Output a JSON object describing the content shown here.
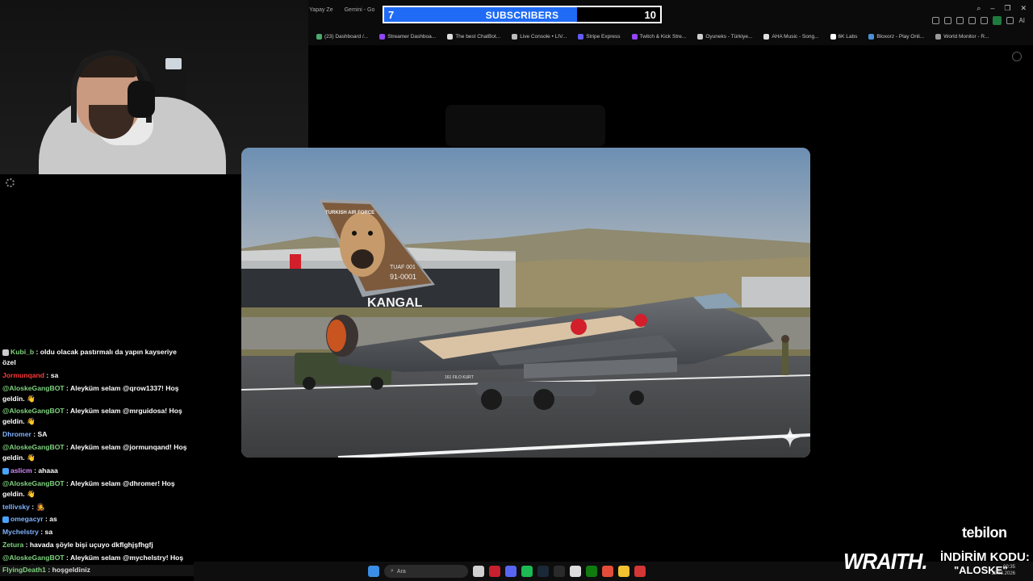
{
  "browser": {
    "tabs": [
      "gle Yapay Ze",
      "Gemini - Go"
    ],
    "bookmarks": [
      {
        "label": "(23) Dashboard /...",
        "color": "#4aa96c"
      },
      {
        "label": "Streamer Dashboa...",
        "color": "#9146ff"
      },
      {
        "label": "The best ChatBot...",
        "color": "#dddddd"
      },
      {
        "label": "Live Console • LIV...",
        "color": "#bbbbbb"
      },
      {
        "label": "Stripe Express",
        "color": "#635bff"
      },
      {
        "label": "Twitch & Kick Stre...",
        "color": "#9146ff"
      },
      {
        "label": "Oyuneks - Türkiye...",
        "color": "#cccccc"
      },
      {
        "label": "AHA Music - Song...",
        "color": "#e0e0e0"
      },
      {
        "label": "6K Labs",
        "color": "#ffffff"
      },
      {
        "label": "Bloxorz - Play Onli...",
        "color": "#4a90d9"
      },
      {
        "label": "World Monitor - R...",
        "color": "#999999"
      }
    ],
    "toolbar_ai": "AI"
  },
  "subscribers_goal": {
    "current": "7",
    "label": "SUBSCRIBERS",
    "target": "10",
    "progress": 0.7,
    "fill_color": "#1f6bf5"
  },
  "photo": {
    "tail_text": "TURKISH AIR FORCE",
    "tail_code_1": "TUAF 001",
    "tail_code_2": "91-0001",
    "name": "KANGAL",
    "squadron": "161 FILO KURT"
  },
  "chat": {
    "messages": [
      {
        "user": "Kubi_b",
        "text": "oldu olacak pastırmalı da yapın kayseriye özel",
        "user_color": "#7fd37f",
        "badge": "#cccccc"
      },
      {
        "user": "Jormunqand",
        "text": "sa",
        "user_color": "#ff3a3a",
        "badge": ""
      },
      {
        "user": "@AloskeGangBOT",
        "text": "Aleyküm selam @qrow1337! Hoş geldin. 👋",
        "user_color": "#7fd37f",
        "badge": ""
      },
      {
        "user": "@AloskeGangBOT",
        "text": "Aleyküm selam @mrguidosa! Hoş geldin. 👋",
        "user_color": "#7fd37f",
        "badge": ""
      },
      {
        "user": "Dhromer",
        "text": "SA",
        "user_color": "#7fb2ff",
        "badge": ""
      },
      {
        "user": "@AloskeGangBOT",
        "text": "Aleyküm selam @jormunqand! Hoş geldin. 👋",
        "user_color": "#7fd37f",
        "badge": ""
      },
      {
        "user": "aslicm",
        "text": "ahaaa",
        "user_color": "#d58cff",
        "badge": "#4aa3ff"
      },
      {
        "user": "@AloskeGangBOT",
        "text": "Aleyküm selam @dhromer! Hoş geldin. 👋",
        "user_color": "#7fd37f",
        "badge": ""
      },
      {
        "user": "tellivsky",
        "text": "🧑‍🎤",
        "user_color": "#7fb2ff",
        "badge": ""
      },
      {
        "user": "omegacyr",
        "text": "as",
        "user_color": "#7fb2ff",
        "badge": "#4aa3ff"
      },
      {
        "user": "Mychelstry",
        "text": "sa",
        "user_color": "#7fb2ff",
        "badge": ""
      },
      {
        "user": "Zetura",
        "text": "havada şöyle bişi uçuyo dkflghjşfhgfj",
        "user_color": "#7fd37f",
        "badge": ""
      },
      {
        "user": "@AloskeGangBOT",
        "text": "Aleyküm selam @mychelstry! Hoş geldin. 👋",
        "user_color": "#7fd37f",
        "badge": ""
      }
    ],
    "last": {
      "user": "FlyingDeath1",
      "text": "hoşgeldiniz",
      "user_color": "#7fd37f"
    }
  },
  "taskbar": {
    "search_placeholder": "Ara",
    "time": "00:35",
    "date": "11.03.2026"
  },
  "sponsor": {
    "brand_top": "tebilon",
    "brand_main": "WRAITH.",
    "code_label": "İNDİRİM KODU:",
    "code": "\"ALOSKE\""
  }
}
